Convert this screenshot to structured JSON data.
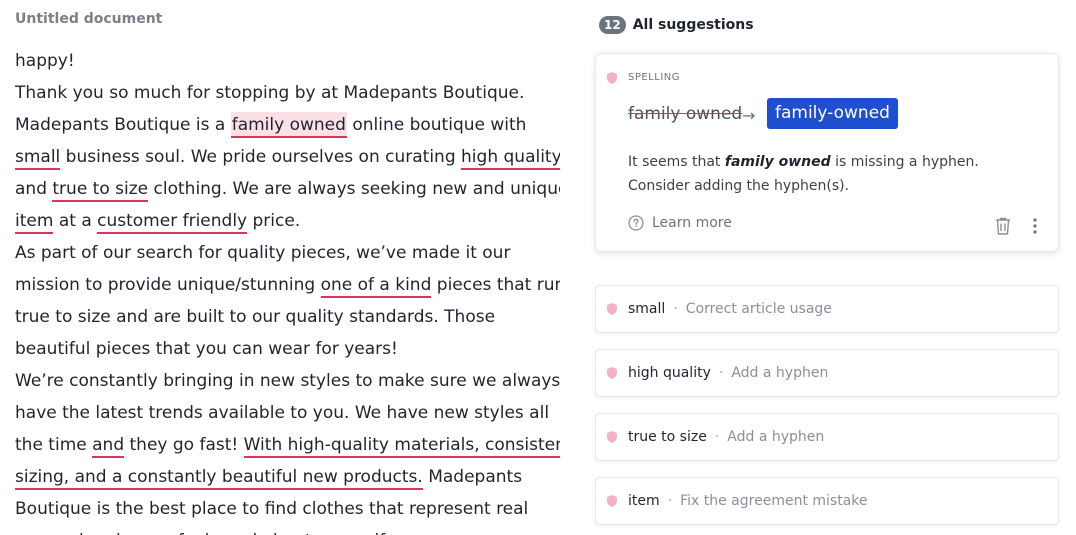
{
  "document": {
    "title": "Untitled document",
    "lines": [
      [
        {
          "t": "happy!"
        }
      ],
      [
        {
          "t": "Thank you so much for stopping by at Madepants Boutique."
        }
      ],
      [
        {
          "t": "Madepants Boutique is a "
        },
        {
          "t": "family owned",
          "s": "hl"
        },
        {
          "t": " online boutique with"
        }
      ],
      [
        {
          "t": "small",
          "s": "u"
        },
        {
          "t": " business soul. We pride ourselves on curating "
        },
        {
          "t": "high quality",
          "s": "u"
        }
      ],
      [
        {
          "t": "and "
        },
        {
          "t": "true to size",
          "s": "u"
        },
        {
          "t": " clothing. We are always seeking new and unique"
        }
      ],
      [
        {
          "t": "item",
          "s": "u"
        },
        {
          "t": " at a "
        },
        {
          "t": "customer friendly",
          "s": "u"
        },
        {
          "t": " price."
        }
      ],
      [
        {
          "t": "As part of our search for quality pieces, we’ve made it our"
        }
      ],
      [
        {
          "t": "mission to provide unique/stunning "
        },
        {
          "t": "one of a kind",
          "s": "u"
        },
        {
          "t": " pieces that run"
        }
      ],
      [
        {
          "t": "true to size and are built to our quality standards. Those"
        }
      ],
      [
        {
          "t": "beautiful pieces that you can wear for years!"
        }
      ],
      [
        {
          "t": "We’re constantly bringing in new styles to make sure we always"
        }
      ],
      [
        {
          "t": "have the latest trends available to you. We have new styles all"
        }
      ],
      [
        {
          "t": "the time "
        },
        {
          "t": "and",
          "s": "u"
        },
        {
          "t": " they go fast! "
        },
        {
          "t": "With high-quality materials, consistent",
          "s": "u"
        }
      ],
      [
        {
          "t": "sizing, and a constantly beautiful new products.",
          "s": "u"
        },
        {
          "t": " Madepants"
        }
      ],
      [
        {
          "t": "Boutique is the best place to find clothes that represent real"
        }
      ],
      [
        {
          "t": "you and make you feel good about yourself."
        }
      ]
    ]
  },
  "suggestions": {
    "count": "12",
    "title": "All suggestions",
    "active": {
      "category": "SPELLING",
      "original": "family owned",
      "replacement": "family-owned",
      "desc_before": "It seems that ",
      "desc_term": "family owned",
      "desc_after": " is missing a hyphen. Consider adding the hyphen(s).",
      "learn_more": "Learn more"
    },
    "items": [
      {
        "word": "small",
        "sep": "·",
        "note": "Correct article usage"
      },
      {
        "word": "high quality",
        "sep": "·",
        "note": "Add a hyphen"
      },
      {
        "word": "true to size",
        "sep": "·",
        "note": "Add a hyphen"
      },
      {
        "word": "item",
        "sep": "·",
        "note": "Fix the agreement mistake"
      }
    ]
  },
  "colors": {
    "underline": "#d7355b",
    "highlight": "#fbe0e6",
    "accent": "#1f4fd1",
    "badge": "#6b7280"
  },
  "icons": {
    "category": "shield-icon",
    "arrow": "arrow-right-icon",
    "learn": "question-circle-icon",
    "delete": "trash-icon",
    "more": "more-vertical-icon"
  }
}
